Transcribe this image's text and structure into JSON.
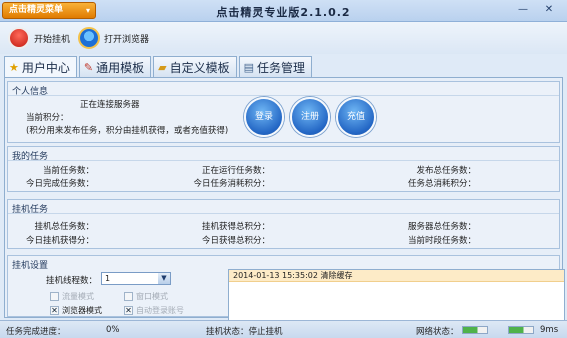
{
  "titlebar": {
    "menu_label": "点击精灵菜单",
    "menu_arrow": "▾",
    "title": "点击精灵专业版2.1.0.2",
    "minimize": "—",
    "close": "✕"
  },
  "toolbar": {
    "start_label": "开始挂机",
    "browser_label": "打开浏览器"
  },
  "tabs": [
    {
      "label": "用户中心",
      "icon": "star-icon"
    },
    {
      "label": "通用模板",
      "icon": "pencil-icon"
    },
    {
      "label": "自定义模板",
      "icon": "folder-icon"
    },
    {
      "label": "任务管理",
      "icon": "document-icon"
    }
  ],
  "personal": {
    "title": "个人信息",
    "connecting": "正在连接服务器",
    "points_label": "当前积分：",
    "points_hint": "(积分用来发布任务，积分由挂机获得，或者充值获得)",
    "login": "登录",
    "register": "注册",
    "recharge": "充值"
  },
  "my_tasks": {
    "title": "我的任务",
    "current_tasks": "当前任务数：",
    "running_tasks": "正在运行任务数：",
    "published_total": "发布总任务数：",
    "today_done": "今日完成任务数：",
    "today_spent": "今日任务消耗积分：",
    "total_spent": "任务总消耗积分："
  },
  "hang_tasks": {
    "title": "挂机任务",
    "hang_total": "挂机总任务数：",
    "hang_points_total": "挂机获得总积分：",
    "server_total": "服务器总任务数：",
    "today_hang_points": "今日挂机获得分：",
    "today_points": "今日获得总积分：",
    "current_period": "当前时段任务数："
  },
  "settings": {
    "title": "挂机设置",
    "threads_label": "挂机线程数：",
    "threads_value": "1",
    "flow_mode": "流量模式",
    "window_mode": "窗口模式",
    "browser_mode": "浏览器模式",
    "auto_login": "自动登录账号",
    "log": "2014-01-13 15:35:02 清除缓存"
  },
  "status": {
    "progress_label": "任务完成进度：",
    "progress_value": "0%",
    "hang_status": "挂机状态：停止挂机",
    "network_label": "网络状态：",
    "latency": "9ms"
  }
}
